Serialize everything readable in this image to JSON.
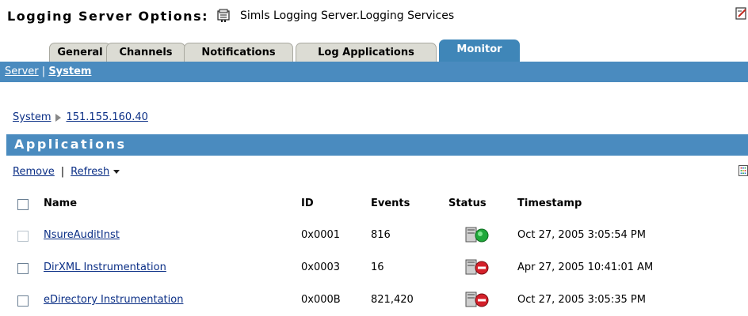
{
  "header": {
    "title": "Logging Server Options:",
    "subject": "Simls Logging Server.Logging Services"
  },
  "tabs": [
    {
      "label": "General",
      "active": false
    },
    {
      "label": "Channels",
      "active": false
    },
    {
      "label": "Notifications",
      "active": false
    },
    {
      "label": "Log Applications",
      "active": false
    },
    {
      "label": "Monitor",
      "active": true
    }
  ],
  "subnav": {
    "server": "Server",
    "separator": "|",
    "system": "System"
  },
  "breadcrumb": {
    "root": "System",
    "current": "151.155.160.40"
  },
  "applications": {
    "title": "Applications",
    "remove": "Remove",
    "separator": "|",
    "refresh": "Refresh",
    "columns": {
      "name": "Name",
      "id": "ID",
      "events": "Events",
      "status": "Status",
      "timestamp": "Timestamp"
    },
    "rows": [
      {
        "name": "NsureAuditInst",
        "id": "0x0001",
        "events": "816",
        "status": "running",
        "timestamp": "Oct 27, 2005 3:05:54 PM"
      },
      {
        "name": "DirXML Instrumentation",
        "id": "0x0003",
        "events": "16",
        "status": "stopped",
        "timestamp": "Apr 27, 2005 10:41:01 AM"
      },
      {
        "name": "eDirectory Instrumentation",
        "id": "0x000B",
        "events": "821,420",
        "status": "stopped",
        "timestamp": "Oct 27, 2005 3:05:35 PM"
      }
    ]
  },
  "colors": {
    "bar_blue": "#4a8bbf",
    "link": "#0b2f86",
    "status_running": "#1fa83a",
    "status_stopped": "#d4202a"
  },
  "icons": {
    "object": "server-object-icon",
    "edit": "edit-icon",
    "columns": "column-chooser-icon",
    "status": "server-status-icon"
  }
}
